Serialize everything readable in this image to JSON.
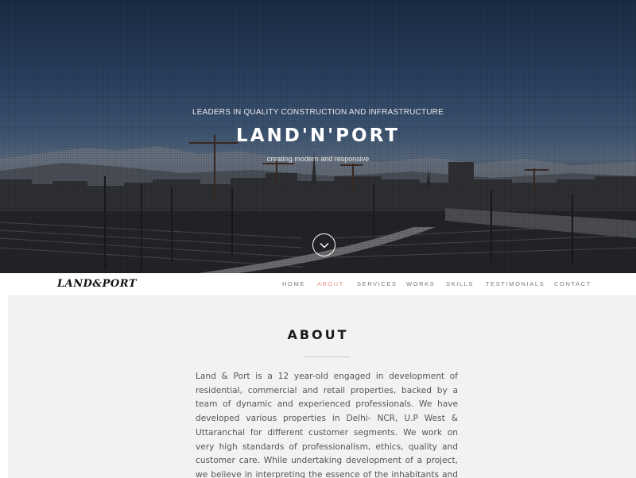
{
  "hero": {
    "tagline": "LEADERS IN QUALITY CONSTRUCTION AND INFRASTRUCTURE",
    "title": "LAND'N'PORT",
    "subtitle": "creating modern and responsive",
    "scroll_icon": "chevron-down-icon"
  },
  "navbar": {
    "brand": "LAND&PORT",
    "items": [
      {
        "label": "HOME"
      },
      {
        "label": "ABOUT",
        "active": true
      },
      {
        "label": "SERVICES"
      },
      {
        "label": "WORKS"
      },
      {
        "label": "SKILLS"
      },
      {
        "label": "TESTIMONIALS"
      },
      {
        "label": "CONTACT"
      }
    ]
  },
  "about": {
    "title": "ABOUT",
    "body": "Land & Port is a 12 year-old engaged in development of residential, commercial and retail properties, backed by a team of dynamic and experienced professionals. We have developed various properties in Delhi- NCR, U.P West & Uttaranchal for different customer segments. We work on very high standards of professionalism, ethics, quality and customer care. While undertaking development of a project, we believe in interpreting the essence of the inhabitants and reflect that style"
  },
  "colors": {
    "accent": "#e8928a",
    "nav_text": "#777777",
    "section_bg": "#f2f2f2"
  }
}
